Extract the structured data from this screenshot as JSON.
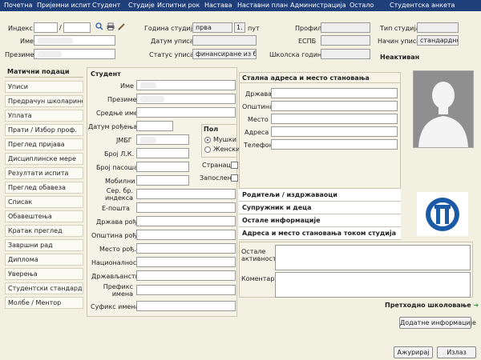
{
  "menu": [
    "Почетна",
    "Пријемни испит",
    "Студент",
    "Студије",
    "Испитни рок",
    "Настава",
    "Наставни план",
    "Администрација",
    "Остало",
    "Студентска анкета"
  ],
  "header": {
    "index_label": "Индекс",
    "index_sep": "/",
    "name_label": "Име",
    "surname_label": "Презиме",
    "study_year_label": "Година студија",
    "study_year_value": "прва",
    "time_value": "1.",
    "time_suffix": "пут",
    "enroll_date_label": "Датум уписа",
    "enroll_status_label": "Статус уписа",
    "enroll_status_value": "финансиране из буџ",
    "profile_label": "Профил",
    "espb_label": "ЕСПБ",
    "school_year_label": "Школска година",
    "study_type_label": "Тип студија",
    "enroll_mode_label": "Начин уписа",
    "enroll_mode_value": "стандардно",
    "status_text": "Неактиван"
  },
  "sidebar": {
    "title": "Матични подаци",
    "items": [
      "Уписи",
      "Предрачун школарине",
      "Уплата",
      "Прати / Избор проф.",
      "Преглед пријава",
      "Дисциплинске мере",
      "Резултати испита",
      "Преглед обавеза",
      "Списак",
      "Обавештења",
      "Кратак преглед",
      "Завршни рад",
      "Диплома",
      "Уверења",
      "Студентски стандард",
      "Молбе / Ментор"
    ]
  },
  "student": {
    "title": "Студент",
    "fields": [
      "Име",
      "Презиме",
      "Средње име",
      "Датум рођења",
      "ЈМБГ",
      "Број Л.К.",
      "Број пасоша",
      "Мобилни",
      "Сер. бр. индекса",
      "Е-пошта",
      "Држава рођ.",
      "Општина рођ.",
      "Место рођ.",
      "Националност",
      "Држављанство",
      "Префикс имена",
      "Суфикс имена"
    ],
    "gender_label": "Пол",
    "male": "Мушки",
    "female": "Женски",
    "foreigner": "Странац",
    "employed": "Запослен"
  },
  "address": {
    "title": "Стална адреса и место становања",
    "fields": [
      "Држава",
      "Општина",
      "Место",
      "Адреса",
      "Телефон"
    ]
  },
  "sections": [
    "Родитељи / издржаваоци",
    "Супружник и деца",
    "Остале информације",
    "Адреса и место становања током студија"
  ],
  "notes": {
    "other_activities": "Остале активности",
    "comment": "Коментар"
  },
  "buttons": {
    "previous_school": "Претходно школовање",
    "extra_info": "Додатне информације",
    "update": "Ажурирај",
    "exit": "Излаз"
  },
  "colors": {
    "menubar": "#1f3f7a",
    "background": "#f2f0e1",
    "arrow": "#2e9a2e"
  }
}
